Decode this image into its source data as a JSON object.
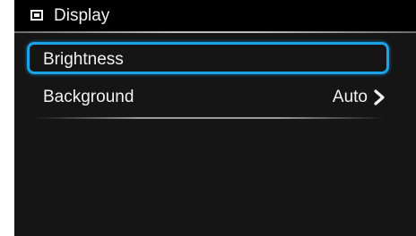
{
  "header": {
    "icon": "display-icon",
    "title": "Display"
  },
  "menu": {
    "items": [
      {
        "label": "Brightness",
        "selected": true
      },
      {
        "label": "Background",
        "value": "Auto",
        "icon": "chevron-right-icon"
      }
    ]
  },
  "colors": {
    "background": "#151515",
    "header": "#000000",
    "focus": "#1aa3e6",
    "text": "#f2f2f2"
  }
}
